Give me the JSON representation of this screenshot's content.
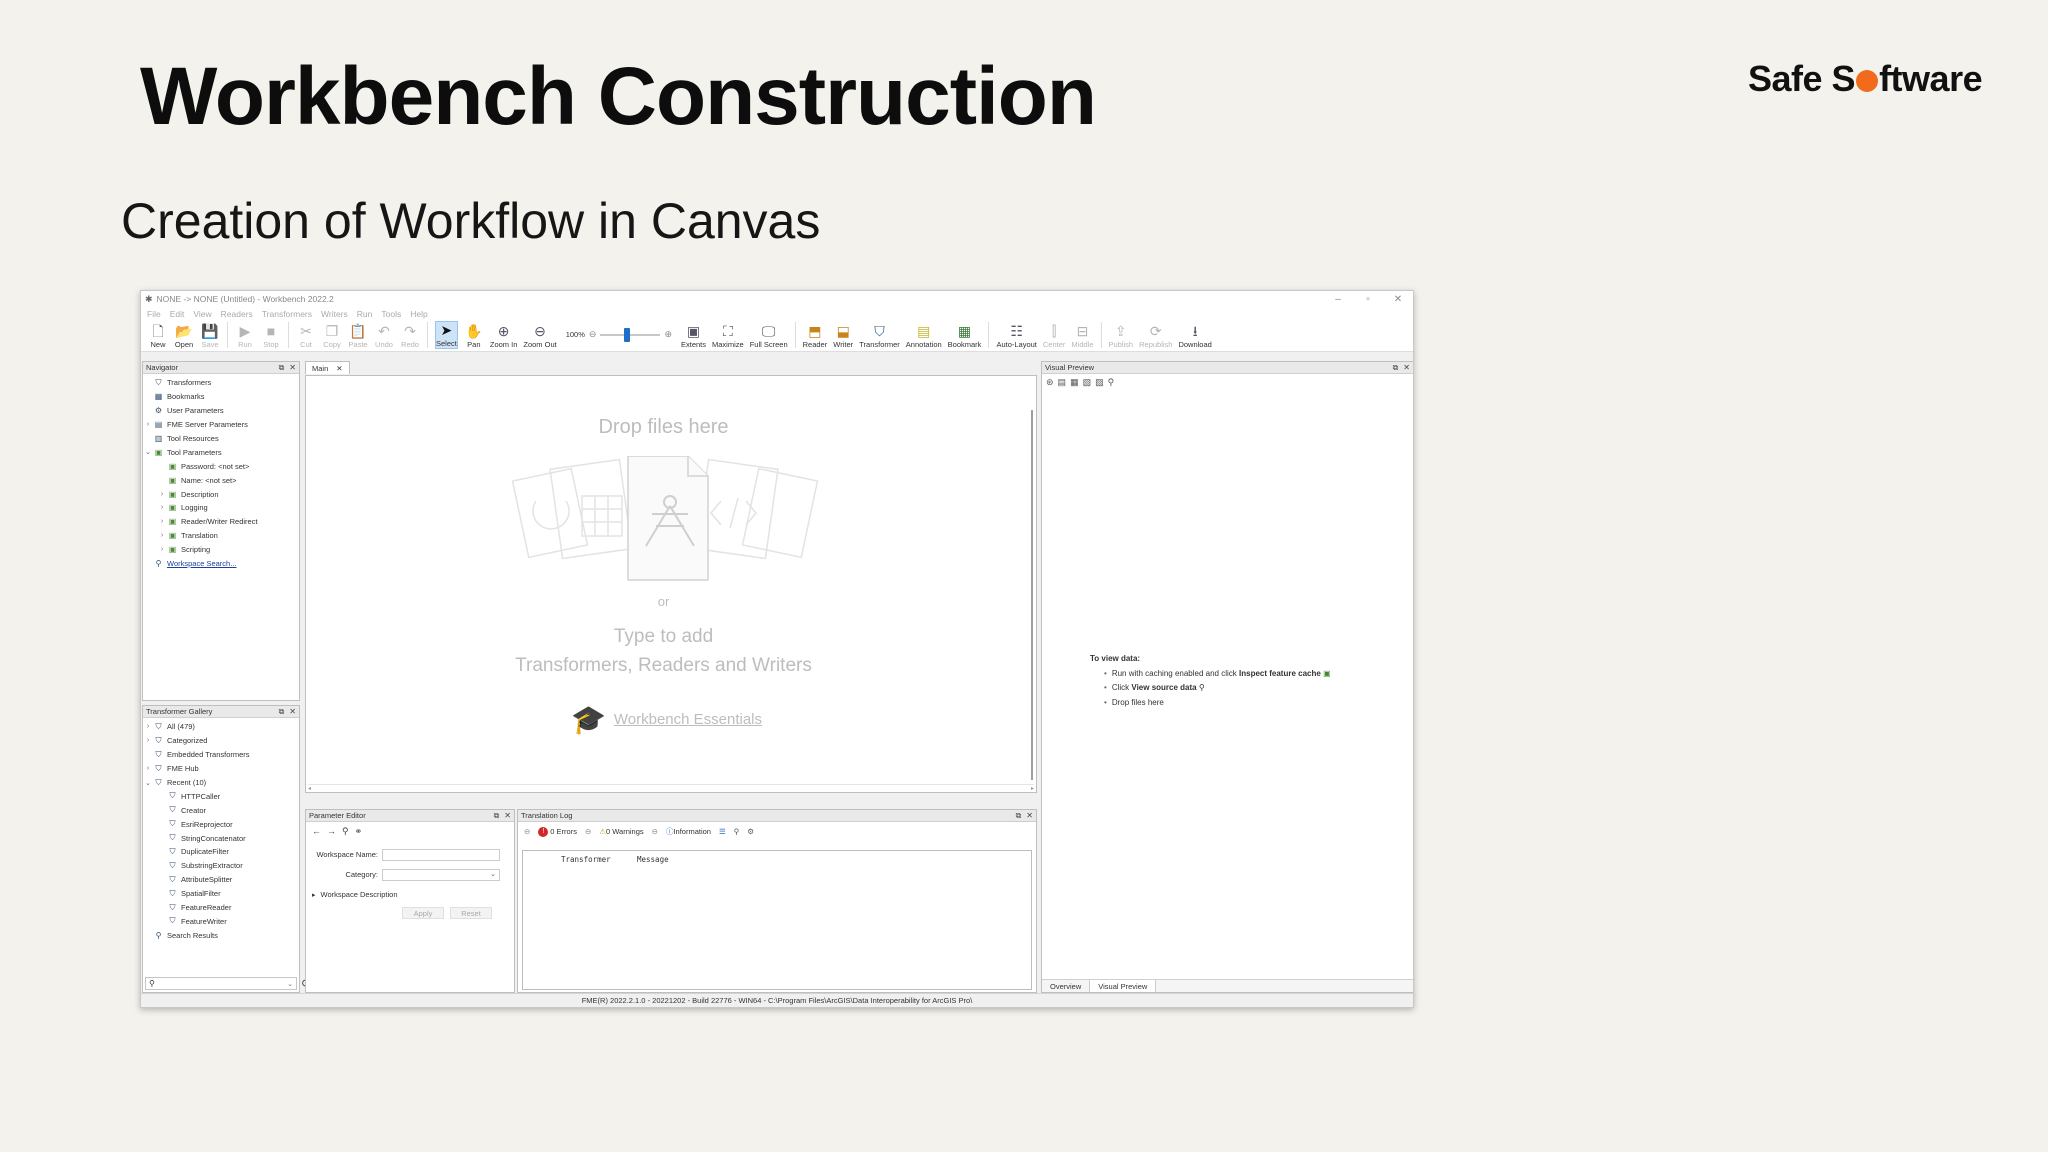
{
  "slide": {
    "title": "Workbench Construction",
    "subtitle": "Creation of Workflow in Canvas",
    "logo_pre": "Safe S",
    "logo_post": "ftware",
    "accent_color": "#f26b1d"
  },
  "window": {
    "title": "NONE -> NONE (Untitled) - Workbench 2022.2",
    "menus": [
      "File",
      "Edit",
      "View",
      "Readers",
      "Transformers",
      "Writers",
      "Run",
      "Tools",
      "Help"
    ],
    "toolbar": {
      "new": "New",
      "open": "Open",
      "save": "Save",
      "run": "Run",
      "stop": "Stop",
      "cut": "Cut",
      "copy": "Copy",
      "paste": "Paste",
      "undo": "Undo",
      "redo": "Redo",
      "select": "Select",
      "pan": "Pan",
      "zoom_in": "Zoom In",
      "zoom_out": "Zoom Out",
      "zoom_value": "100%",
      "extents": "Extents",
      "maximize": "Maximize",
      "full_screen": "Full Screen",
      "reader": "Reader",
      "writer": "Writer",
      "transformer": "Transformer",
      "annotation": "Annotation",
      "bookmark": "Bookmark",
      "auto_layout": "Auto-Layout",
      "center": "Center",
      "middle": "Middle",
      "publish": "Publish",
      "republish": "Republish",
      "download": "Download"
    }
  },
  "navigator": {
    "title": "Navigator",
    "items": [
      "Transformers",
      "Bookmarks",
      "User Parameters",
      "FME Server Parameters",
      "Tool Resources",
      "Tool Parameters",
      "Password: <not set>",
      "Name: <not set>",
      "Description",
      "Logging",
      "Reader/Writer Redirect",
      "Translation",
      "Scripting",
      "Workspace Search..."
    ]
  },
  "gallery": {
    "title": "Transformer Gallery",
    "items": [
      "All (479)",
      "Categorized",
      "Embedded Transformers",
      "FME Hub",
      "Recent (10)",
      "HTTPCaller",
      "Creator",
      "EsriReprojector",
      "StringConcatenator",
      "DuplicateFilter",
      "SubstringExtractor",
      "AttributeSplitter",
      "SpatialFilter",
      "FeatureReader",
      "FeatureWriter",
      "Search Results"
    ]
  },
  "canvas": {
    "tab": "Main",
    "drop_text": "Drop files here",
    "or_text": "or",
    "type_text": "Type to add",
    "type_sub": "Transformers, Readers and Writers",
    "essentials": "Workbench Essentials"
  },
  "visual_preview": {
    "title": "Visual Preview",
    "heading": "To view data:",
    "b1_pre": "Run with caching enabled and click",
    "b1_strong": "Inspect feature cache",
    "b2_pre": "Click",
    "b2_strong": "View source data",
    "b3": "Drop files here",
    "tab_overview": "Overview",
    "tab_vp": "Visual Preview"
  },
  "param_editor": {
    "title": "Parameter Editor",
    "ws_name_label": "Workspace Name:",
    "category_label": "Category:",
    "ws_desc": "Workspace Description",
    "apply": "Apply",
    "reset": "Reset"
  },
  "translation_log": {
    "title": "Translation Log",
    "errors": "0 Errors",
    "warnings": "0 Warnings",
    "information": "Information",
    "col_transformer": "Transformer",
    "col_message": "Message"
  },
  "status": "FME(R) 2022.2.1.0 - 20221202 - Build 22776 - WIN64 - C:\\Program Files\\ArcGIS\\Data Interoperability for ArcGIS Pro\\"
}
